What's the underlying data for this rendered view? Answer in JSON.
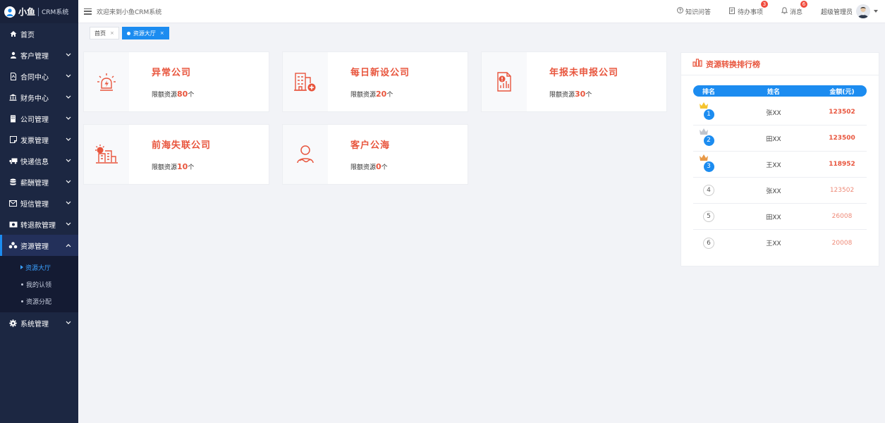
{
  "brand": {
    "name": "小鱼",
    "system": "CRM系统"
  },
  "header": {
    "welcome": "欢迎来到小鱼CRM系统",
    "knowledge_label": "知识问答",
    "todo_label": "待办事项",
    "todo_count": "3",
    "message_label": "消息",
    "message_count": "6",
    "user_name": "超级管理员"
  },
  "sidebar": {
    "items": [
      {
        "label": "首页",
        "icon": "home-icon",
        "has_children": false
      },
      {
        "label": "客户管理",
        "icon": "user-icon",
        "has_children": true
      },
      {
        "label": "合同中心",
        "icon": "contract-icon",
        "has_children": true
      },
      {
        "label": "财务中心",
        "icon": "bank-icon",
        "has_children": true
      },
      {
        "label": "公司管理",
        "icon": "building-icon",
        "has_children": true
      },
      {
        "label": "发票管理",
        "icon": "invoice-icon",
        "has_children": true
      },
      {
        "label": "快递信息",
        "icon": "truck-icon",
        "has_children": true
      },
      {
        "label": "薪酬管理",
        "icon": "database-icon",
        "has_children": true
      },
      {
        "label": "短信管理",
        "icon": "mail-icon",
        "has_children": true
      },
      {
        "label": "转退款管理",
        "icon": "money-icon",
        "has_children": true
      },
      {
        "label": "资源管理",
        "icon": "cubes-icon",
        "has_children": true,
        "expanded": true
      },
      {
        "label": "系统管理",
        "icon": "gear-icon",
        "has_children": true
      }
    ],
    "submenu": [
      "资源大厅",
      "我的认领",
      "资源分配"
    ],
    "active_sub": 0
  },
  "tabs": [
    {
      "label": "首页",
      "active": false
    },
    {
      "label": "资源大厅",
      "active": true
    }
  ],
  "cards": [
    {
      "title": "异常公司",
      "sub": "限额资源",
      "count": "80",
      "unit": "个",
      "icon": "alarm-icon"
    },
    {
      "title": "每日新设公司",
      "sub": "限额资源",
      "count": "20",
      "unit": "个",
      "icon": "new-building-icon"
    },
    {
      "title": "年报未申报公司",
      "sub": "限额资源",
      "count": "30",
      "unit": "个",
      "icon": "report-icon"
    },
    {
      "title": "前海失联公司",
      "sub": "限额资源",
      "count": "10",
      "unit": "个",
      "icon": "sunset-building-icon"
    },
    {
      "title": "客户公海",
      "sub": "限额资源",
      "count": "0",
      "unit": "个",
      "icon": "customer-icon"
    }
  ],
  "ranking": {
    "title": "资源转换排行榜",
    "columns": [
      "排名",
      "姓名",
      "金额(元)"
    ],
    "rows": [
      {
        "rank": "1",
        "name": "张XX",
        "amount": "123502"
      },
      {
        "rank": "2",
        "name": "田XX",
        "amount": "123500"
      },
      {
        "rank": "3",
        "name": "王XX",
        "amount": "118952"
      },
      {
        "rank": "4",
        "name": "张XX",
        "amount": "123502"
      },
      {
        "rank": "5",
        "name": "田XX",
        "amount": "26008"
      },
      {
        "rank": "6",
        "name": "王XX",
        "amount": "20008"
      }
    ]
  },
  "colors": {
    "accent": "#1c8cf0",
    "highlight": "#e8553d",
    "sidebar": "#1c2742",
    "gold": "#f5c430",
    "silver": "#c0c4cc",
    "bronze": "#e89a48"
  }
}
